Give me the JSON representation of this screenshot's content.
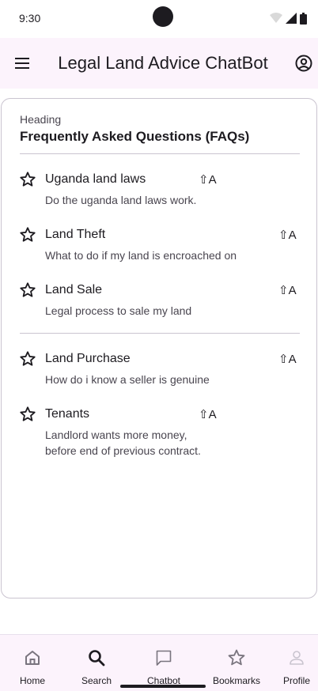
{
  "status_bar": {
    "time": "9:30"
  },
  "app_bar": {
    "title": "Legal Land Advice ChatBot",
    "menu_icon": "menu-icon",
    "account_icon": "account-circle-icon"
  },
  "card": {
    "overline": "Heading",
    "heading": "Frequently Asked Questions (FAQs)"
  },
  "faqs": [
    {
      "title": "Uganda land laws",
      "description": "Do the uganda land laws work.",
      "shortcut": "⇧A",
      "icon": "star-outline-icon"
    },
    {
      "title": "Land Theft",
      "description": "What to do if my land is encroached on",
      "shortcut": "⇧A",
      "icon": "star-outline-icon"
    },
    {
      "title": "Land Sale",
      "description": "Legal process to sale my land",
      "shortcut": "⇧A",
      "icon": "star-outline-icon"
    },
    {
      "title": "Land Purchase",
      "description": "How do i know a seller is genuine",
      "shortcut": "⇧A",
      "icon": "star-outline-icon"
    },
    {
      "title": "Tenants",
      "description": "Landlord wants more money,\nbefore end of previous contract.",
      "shortcut": "⇧A",
      "icon": "star-outline-icon"
    }
  ],
  "nav": [
    {
      "label": "Home",
      "icon": "home-icon"
    },
    {
      "label": "Search",
      "icon": "search-icon"
    },
    {
      "label": "Chatbot",
      "icon": "chat-icon"
    },
    {
      "label": "Bookmarks",
      "icon": "star-icon"
    },
    {
      "label": "Profile",
      "icon": "person-icon"
    }
  ]
}
